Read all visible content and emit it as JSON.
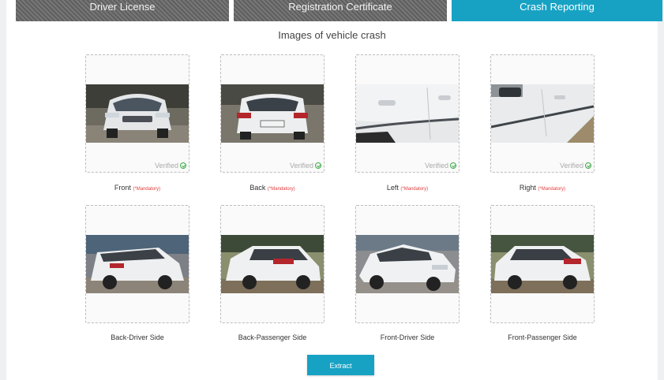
{
  "tabs": [
    {
      "label": "Driver License",
      "state": "inactive"
    },
    {
      "label": "Registration Certificate",
      "state": "inactive"
    },
    {
      "label": "Crash Reporting",
      "state": "active"
    }
  ],
  "section_title": "Images of vehicle crash",
  "mandatory_note": "(*Mandatory)",
  "verified_label": "Verified",
  "slots": [
    {
      "label": "Front",
      "mandatory": true,
      "verified": true
    },
    {
      "label": "Back",
      "mandatory": true,
      "verified": true
    },
    {
      "label": "Left",
      "mandatory": true,
      "verified": true
    },
    {
      "label": "Right",
      "mandatory": true,
      "verified": true
    },
    {
      "label": "Back-Driver Side",
      "mandatory": false,
      "verified": false
    },
    {
      "label": "Back-Passenger Side",
      "mandatory": false,
      "verified": false
    },
    {
      "label": "Front-Driver Side",
      "mandatory": false,
      "verified": false
    },
    {
      "label": "Front-Passenger Side",
      "mandatory": false,
      "verified": false
    }
  ],
  "extract_label": "Extract",
  "colors": {
    "accent": "#17a2c4",
    "verified": "#3aa844",
    "mandatory": "#e23b3b"
  }
}
